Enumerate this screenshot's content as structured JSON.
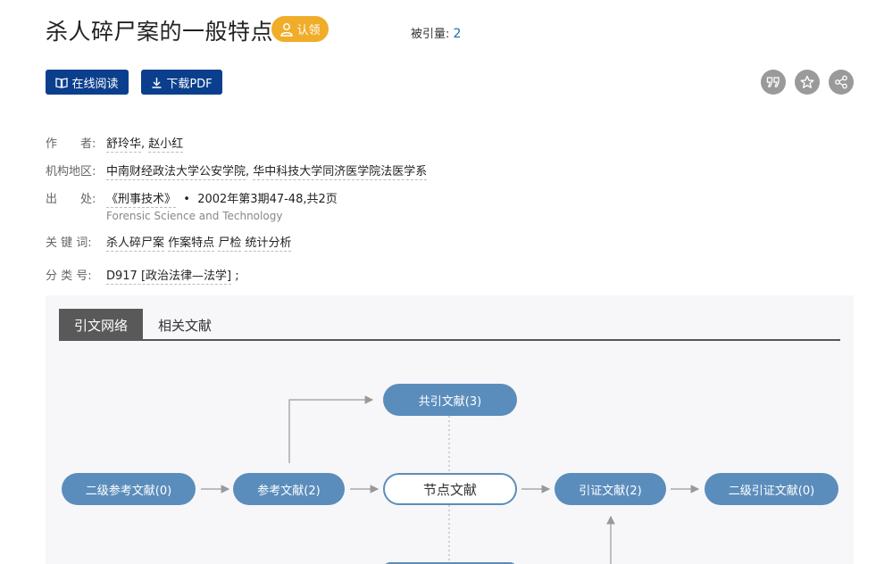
{
  "header": {
    "title": "杀人碎尸案的一般特点",
    "claim_label": "认领",
    "cite_label": "被引量:",
    "cite_count": "2"
  },
  "actions": {
    "read_online": "在线阅读",
    "download_pdf": "下载PDF",
    "icons": [
      "quote-icon",
      "star-icon",
      "share-icon"
    ]
  },
  "meta": {
    "author_label": "作　　者:",
    "authors": [
      "舒玲华",
      "赵小红"
    ],
    "org_label": "机构地区:",
    "orgs": [
      "中南财经政法大学公安学院",
      "华中科技大学同济医学院法医学系"
    ],
    "source_label": "出　　处:",
    "journal": "《刑事技术》",
    "issue": "2002年第3期47-48,共2页",
    "journal_en": "Forensic Science and Technology",
    "keywords_label": "关 键 词:",
    "keywords": [
      "杀人碎尸案",
      "作案特点",
      "尸检",
      "统计分析"
    ],
    "class_label": "分 类 号:",
    "class_code": "D917 [政治法律—法学]",
    "class_suffix": ";"
  },
  "tabs": [
    "引文网络",
    "相关文献"
  ],
  "network": {
    "second_refs": "二级参考文献(0)",
    "refs": "参考文献(2)",
    "center": "节点文献",
    "citing": "引证文献(2)",
    "second_citing": "二级引证文献(0)",
    "co_citing": "共引文献(3)"
  },
  "colors": {
    "brand_blue": "#0b3f8e",
    "node_blue": "#5b8dbc",
    "claim_orange": "#f0ad2a",
    "link_blue": "#1a6ea8"
  }
}
